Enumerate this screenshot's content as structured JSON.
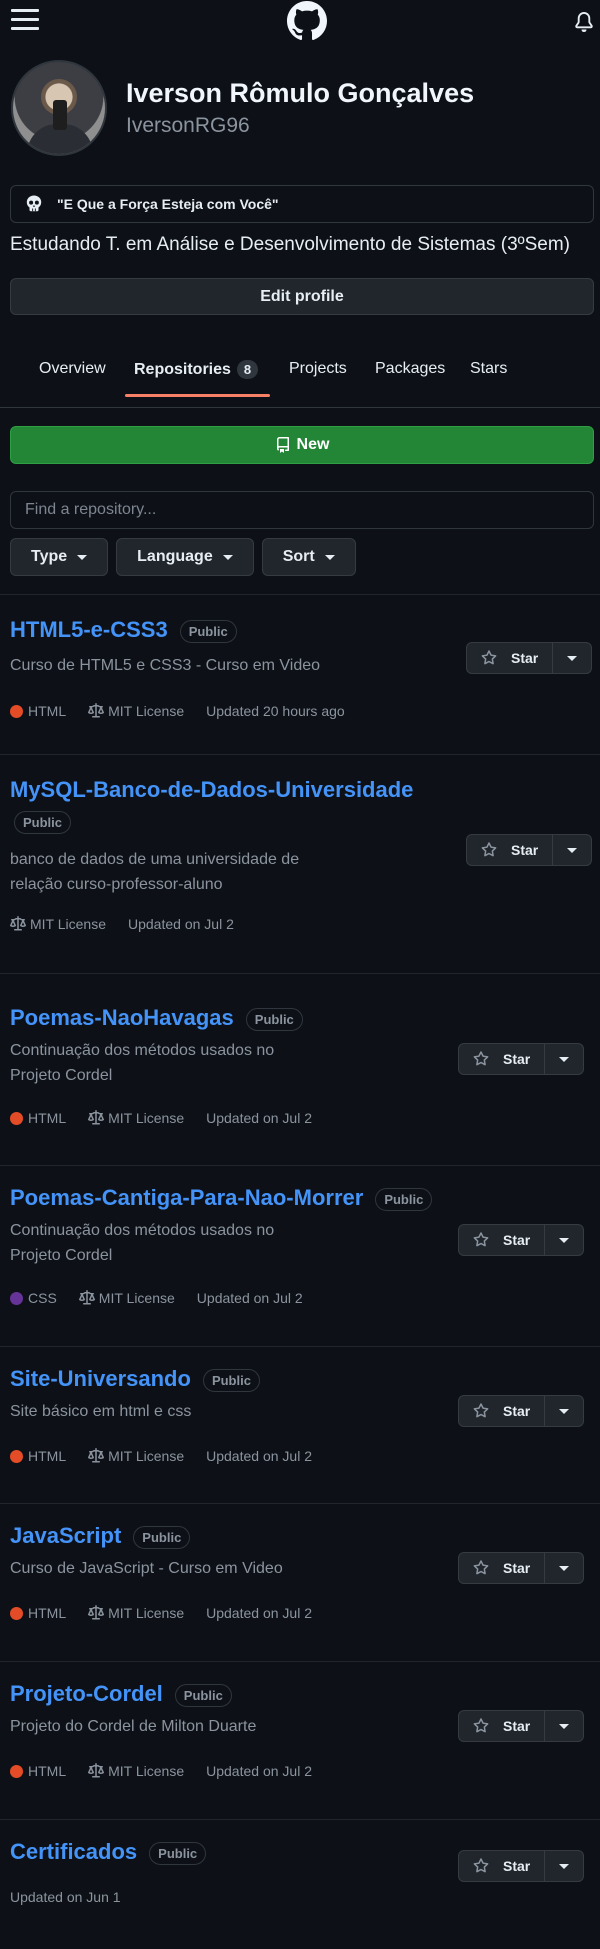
{
  "header": {
    "menu_icon": "hamburger-icon",
    "logo_icon": "github-mark-icon",
    "notifications_icon": "bell-icon"
  },
  "profile": {
    "full_name": "Iverson Rômulo Gonçalves",
    "username": "IversonRG96",
    "status_emoji": "skull-icon",
    "status_text": "\"E Que a Força Esteja com Você\"",
    "bio": "Estudando T. em Análise e Desenvolvimento de Sistemas (3ºSem)",
    "edit_label": "Edit profile"
  },
  "tabs": [
    {
      "label": "Overview"
    },
    {
      "label": "Repositories",
      "count": "8",
      "active": true
    },
    {
      "label": "Projects"
    },
    {
      "label": "Packages"
    },
    {
      "label": "Stars"
    }
  ],
  "toolbar": {
    "new_label": "New",
    "search_placeholder": "Find a repository...",
    "filters": [
      "Type",
      "Language",
      "Sort"
    ]
  },
  "colors": {
    "html": "#e34c26",
    "css": "#663399",
    "accent": "#4493f8",
    "new_button": "#238636",
    "tab_underline": "#f78166"
  },
  "repos": [
    {
      "name": "HTML5-e-CSS3",
      "visibility": "Public",
      "desc_lines": [
        "Curso de HTML5 e CSS3 - Curso em Video"
      ],
      "language": "HTML",
      "license": "MIT License",
      "updated": "Updated 20 hours ago",
      "star_label": "Star"
    },
    {
      "name": "MySQL-Banco-de-Dados-Universidade",
      "visibility": "Public",
      "desc_lines": [
        "banco de dados de uma universidade de",
        "relação curso-professor-aluno"
      ],
      "language": "",
      "license": "MIT License",
      "updated": "Updated on Jul 2",
      "star_label": "Star"
    },
    {
      "name": "Poemas-NaoHavagas",
      "visibility": "Public",
      "desc_lines": [
        "Continuação dos métodos usados no",
        "Projeto Cordel"
      ],
      "language": "HTML",
      "license": "MIT License",
      "updated": "Updated on Jul 2",
      "star_label": "Star"
    },
    {
      "name": "Poemas-Cantiga-Para-Nao-Morrer",
      "visibility": "Public",
      "desc_lines": [
        "Continuação dos métodos usados no",
        "Projeto Cordel"
      ],
      "language": "CSS",
      "license": "MIT License",
      "updated": "Updated on Jul 2",
      "star_label": "Star"
    },
    {
      "name": "Site-Universando",
      "visibility": "Public",
      "desc_lines": [
        "Site básico em html e css"
      ],
      "language": "HTML",
      "license": "MIT License",
      "updated": "Updated on Jul 2",
      "star_label": "Star"
    },
    {
      "name": "JavaScript",
      "visibility": "Public",
      "desc_lines": [
        "Curso de JavaScript - Curso em Video"
      ],
      "language": "HTML",
      "license": "MIT License",
      "updated": "Updated on Jul 2",
      "star_label": "Star"
    },
    {
      "name": "Projeto-Cordel",
      "visibility": "Public",
      "desc_lines": [
        "Projeto do Cordel de Milton Duarte"
      ],
      "language": "HTML",
      "license": "MIT License",
      "updated": "Updated on Jul 2",
      "star_label": "Star"
    },
    {
      "name": "Certificados",
      "visibility": "Public",
      "desc_lines": [],
      "language": "",
      "license": "",
      "updated": "Updated on Jun 1",
      "star_label": "Star"
    }
  ]
}
